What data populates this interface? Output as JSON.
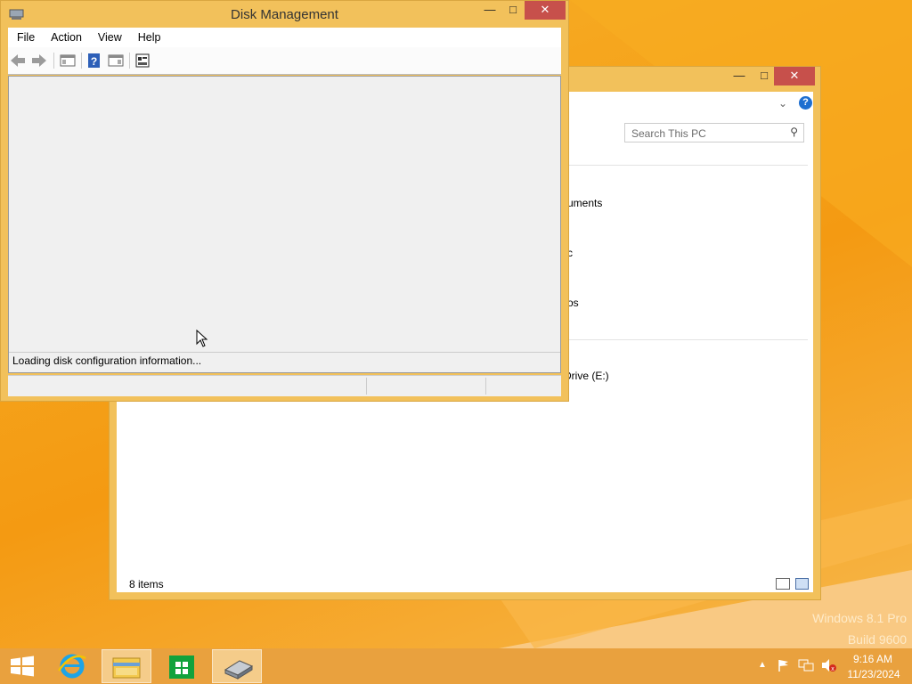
{
  "desktop": {
    "watermark_line1": "Windows 8.1 Pro",
    "watermark_line2": "Build 9600"
  },
  "explorer": {
    "search_placeholder": "Search This PC",
    "items": [
      "uments",
      "c",
      "os",
      "Drive (E:)"
    ],
    "status": "8 items"
  },
  "disk_management": {
    "title": "Disk Management",
    "menu": [
      "File",
      "Action",
      "View",
      "Help"
    ],
    "loading_text": "Loading disk configuration information..."
  },
  "taskbar": {
    "time": "9:16 AM",
    "date": "11/23/2024"
  },
  "colors": {
    "desktop": "#f6a51a",
    "window_frame": "#f2c15b",
    "close_button": "#c7504b",
    "taskbar": "#e9a13e"
  }
}
